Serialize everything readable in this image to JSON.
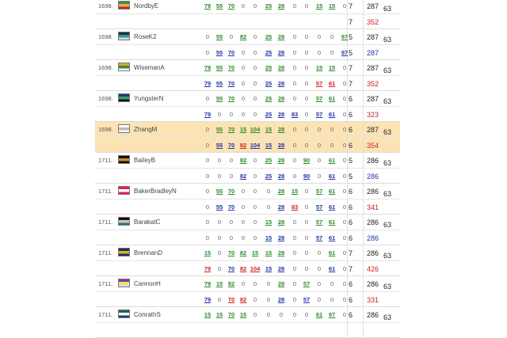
{
  "players": [
    {
      "rank": "1698.",
      "name": "NordbyE",
      "flag": [
        "#3b8e4e",
        "#e0b040",
        "#c23"
      ],
      "row1": [
        "79",
        "55",
        "70",
        "0",
        "0",
        "25",
        "28",
        "0",
        "0",
        "15",
        "15",
        "0"
      ],
      "c1": [
        "g",
        "g",
        "g",
        "z",
        "z",
        "g",
        "g",
        "z",
        "z",
        "g",
        "g",
        "z"
      ],
      "t1": [
        "7",
        "287"
      ],
      "row2": [
        "",
        "",
        "",
        "",
        "",
        "",
        "",
        "",
        "",
        "",
        "",
        ""
      ],
      "c2": [],
      "t2": [
        "7",
        "352"
      ],
      "t2cls": "red",
      "score": "63",
      "hl": false
    },
    {
      "rank": "1698.",
      "name": "RoseK2",
      "flag": [
        "#16304a",
        "#3b9a8c",
        "#cde"
      ],
      "row1": [
        "0",
        "55",
        "0",
        "82",
        "0",
        "25",
        "28",
        "0",
        "0",
        "0",
        "0",
        "97"
      ],
      "c1": [
        "z",
        "g",
        "z",
        "g",
        "z",
        "g",
        "g",
        "z",
        "z",
        "z",
        "z",
        "g"
      ],
      "t1": [
        "5",
        "287"
      ],
      "row2": [
        "0",
        "55",
        "70",
        "0",
        "0",
        "25",
        "28",
        "0",
        "0",
        "0",
        "0",
        "97"
      ],
      "c2": [
        "z",
        "b",
        "b",
        "z",
        "z",
        "b",
        "b",
        "z",
        "z",
        "z",
        "z",
        "b"
      ],
      "t2": [
        "5",
        "287"
      ],
      "t2cls": "blue",
      "score": "63",
      "hl": false
    },
    {
      "rank": "1698.",
      "name": "WisemanA",
      "flag": [
        "#e8a020",
        "#2e8c4c",
        "#fff"
      ],
      "row1": [
        "79",
        "55",
        "70",
        "0",
        "0",
        "25",
        "28",
        "0",
        "0",
        "15",
        "15",
        "0"
      ],
      "c1": [
        "g",
        "g",
        "g",
        "z",
        "z",
        "g",
        "g",
        "z",
        "z",
        "g",
        "g",
        "z"
      ],
      "t1": [
        "7",
        "287"
      ],
      "row2": [
        "79",
        "55",
        "70",
        "0",
        "0",
        "25",
        "28",
        "0",
        "0",
        "57",
        "61",
        "0"
      ],
      "c2": [
        "b",
        "b",
        "b",
        "z",
        "z",
        "b",
        "b",
        "z",
        "z",
        "r",
        "r",
        "z"
      ],
      "t2": [
        "7",
        "352"
      ],
      "t2cls": "red",
      "score": "63",
      "hl": false
    },
    {
      "rank": "1698.",
      "name": "YungsterN",
      "flag": [
        "#1a3c7a",
        "#3aa060",
        "#111"
      ],
      "row1": [
        "0",
        "55",
        "70",
        "0",
        "0",
        "25",
        "28",
        "0",
        "0",
        "57",
        "61",
        "0"
      ],
      "c1": [
        "z",
        "g",
        "g",
        "z",
        "z",
        "g",
        "g",
        "z",
        "z",
        "g",
        "g",
        "z"
      ],
      "t1": [
        "6",
        "287"
      ],
      "row2": [
        "79",
        "0",
        "0",
        "0",
        "0",
        "25",
        "28",
        "83",
        "0",
        "57",
        "61",
        "0"
      ],
      "c2": [
        "b",
        "z",
        "z",
        "z",
        "z",
        "b",
        "b",
        "b",
        "z",
        "b",
        "b",
        "z"
      ],
      "t2": [
        "6",
        "323"
      ],
      "t2cls": "red",
      "score": "63",
      "hl": false
    },
    {
      "rank": "1698.",
      "name": "ZhangM",
      "flag": [
        "#fff",
        "#bbb",
        "#fff"
      ],
      "row1": [
        "0",
        "55",
        "70",
        "15",
        "104",
        "15",
        "28",
        "0",
        "0",
        "0",
        "0",
        "0"
      ],
      "c1": [
        "z",
        "g",
        "g",
        "g",
        "g",
        "g",
        "g",
        "z",
        "z",
        "z",
        "z",
        "z"
      ],
      "t1": [
        "6",
        "287"
      ],
      "row2": [
        "0",
        "55",
        "70",
        "82",
        "104",
        "15",
        "28",
        "0",
        "0",
        "0",
        "0",
        "0"
      ],
      "c2": [
        "z",
        "b",
        "b",
        "r",
        "b",
        "b",
        "b",
        "z",
        "z",
        "z",
        "z",
        "z"
      ],
      "t2": [
        "6",
        "354"
      ],
      "t2cls": "red",
      "score": "63",
      "hl": true
    },
    {
      "rank": "1711.",
      "name": "BaileyB",
      "flag": [
        "#111",
        "#c8901a",
        "#111"
      ],
      "row1": [
        "0",
        "0",
        "0",
        "82",
        "0",
        "25",
        "28",
        "0",
        "90",
        "0",
        "61",
        "0"
      ],
      "c1": [
        "z",
        "z",
        "z",
        "g",
        "z",
        "g",
        "g",
        "z",
        "g",
        "z",
        "g",
        "z"
      ],
      "t1": [
        "5",
        "286"
      ],
      "row2": [
        "0",
        "0",
        "0",
        "82",
        "0",
        "25",
        "28",
        "0",
        "90",
        "0",
        "61",
        "0"
      ],
      "c2": [
        "z",
        "z",
        "z",
        "b",
        "z",
        "b",
        "b",
        "z",
        "b",
        "z",
        "b",
        "z"
      ],
      "t2": [
        "5",
        "286"
      ],
      "t2cls": "blue",
      "score": "63",
      "hl": false
    },
    {
      "rank": "1711.",
      "name": "BakerBradleyN",
      "flag": [
        "#e8204a",
        "#fff",
        "#e8204a"
      ],
      "row1": [
        "0",
        "55",
        "70",
        "0",
        "0",
        "0",
        "28",
        "15",
        "0",
        "57",
        "61",
        "0"
      ],
      "c1": [
        "z",
        "g",
        "g",
        "z",
        "z",
        "z",
        "g",
        "g",
        "z",
        "g",
        "g",
        "z"
      ],
      "t1": [
        "6",
        "286"
      ],
      "row2": [
        "0",
        "55",
        "70",
        "0",
        "0",
        "0",
        "28",
        "83",
        "0",
        "57",
        "61",
        "0"
      ],
      "c2": [
        "z",
        "b",
        "b",
        "z",
        "z",
        "z",
        "b",
        "r",
        "z",
        "b",
        "b",
        "z"
      ],
      "t2": [
        "6",
        "341"
      ],
      "t2cls": "red",
      "score": "63",
      "hl": false
    },
    {
      "rank": "1711.",
      "name": "BarakatC",
      "flag": [
        "#111",
        "#d8c8a0",
        "#1a7a9a"
      ],
      "row1": [
        "0",
        "0",
        "0",
        "0",
        "0",
        "15",
        "28",
        "0",
        "0",
        "57",
        "61",
        "0"
      ],
      "c1": [
        "z",
        "z",
        "z",
        "z",
        "z",
        "g",
        "g",
        "z",
        "z",
        "g",
        "g",
        "z"
      ],
      "t1": [
        "6",
        "286"
      ],
      "row2": [
        "0",
        "0",
        "0",
        "0",
        "0",
        "15",
        "28",
        "0",
        "0",
        "57",
        "61",
        "0"
      ],
      "c2": [
        "z",
        "z",
        "z",
        "z",
        "z",
        "b",
        "b",
        "z",
        "z",
        "b",
        "b",
        "z"
      ],
      "t2": [
        "6",
        "286"
      ],
      "t2cls": "blue",
      "score": "63",
      "hl": false
    },
    {
      "rank": "1711.",
      "name": "BrennanD",
      "flag": [
        "#1a3060",
        "#e0b020",
        "#1a3060"
      ],
      "row1": [
        "15",
        "0",
        "70",
        "82",
        "15",
        "15",
        "28",
        "0",
        "0",
        "0",
        "61",
        "0"
      ],
      "c1": [
        "g",
        "z",
        "g",
        "g",
        "g",
        "g",
        "g",
        "z",
        "z",
        "z",
        "g",
        "z"
      ],
      "t1": [
        "7",
        "286"
      ],
      "row2": [
        "79",
        "0",
        "70",
        "82",
        "104",
        "15",
        "28",
        "0",
        "0",
        "0",
        "61",
        "0"
      ],
      "c2": [
        "r",
        "z",
        "b",
        "r",
        "r",
        "b",
        "b",
        "z",
        "z",
        "z",
        "b",
        "z"
      ],
      "t2": [
        "7",
        "426"
      ],
      "t2cls": "red",
      "score": "63",
      "hl": false
    },
    {
      "rank": "1711.",
      "name": "CannonH",
      "flag": [
        "#7a3aa0",
        "#f0e060",
        "#ddd"
      ],
      "row1": [
        "79",
        "15",
        "82",
        "0",
        "0",
        "0",
        "28",
        "0",
        "57",
        "0",
        "0",
        "0"
      ],
      "c1": [
        "g",
        "g",
        "g",
        "z",
        "z",
        "z",
        "g",
        "z",
        "g",
        "z",
        "z",
        "z"
      ],
      "t1": [
        "6",
        "286"
      ],
      "row2": [
        "79",
        "0",
        "70",
        "82",
        "0",
        "0",
        "28",
        "0",
        "57",
        "0",
        "0",
        "0"
      ],
      "c2": [
        "b",
        "z",
        "r",
        "r",
        "z",
        "z",
        "b",
        "z",
        "b",
        "z",
        "z",
        "z"
      ],
      "t2": [
        "6",
        "331"
      ],
      "t2cls": "red",
      "score": "63",
      "hl": false
    },
    {
      "rank": "1711.",
      "name": "ConrathS",
      "flag": [
        "#1a6a4a",
        "#fff",
        "#1a3a7a"
      ],
      "row1": [
        "15",
        "15",
        "70",
        "15",
        "0",
        "0",
        "0",
        "0",
        "0",
        "61",
        "97",
        "0"
      ],
      "c1": [
        "g",
        "g",
        "g",
        "g",
        "z",
        "z",
        "z",
        "z",
        "z",
        "g",
        "g",
        "z"
      ],
      "t1": [
        "6",
        "286"
      ],
      "row2": [
        "",
        "",
        "",
        "",
        "",
        "",
        "",
        "",
        "",
        "",
        "",
        ""
      ],
      "c2": [],
      "t2": [
        "",
        ""
      ],
      "t2cls": "blue",
      "score": "63",
      "hl": false
    }
  ]
}
